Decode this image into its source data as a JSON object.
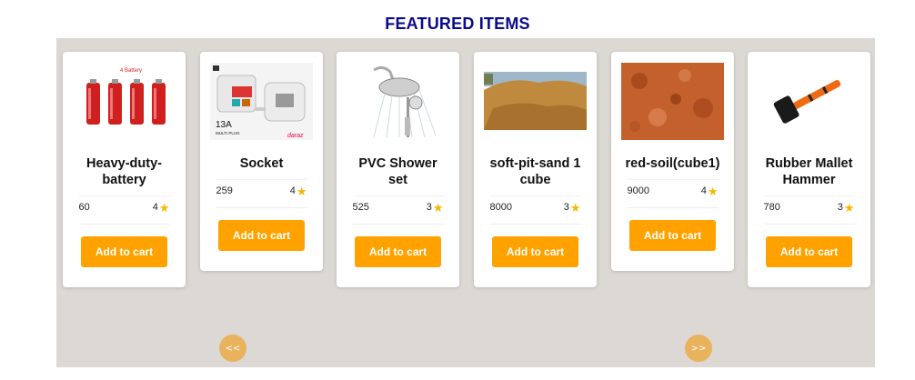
{
  "section": {
    "title": "FEATURED ITEMS"
  },
  "products": [
    {
      "name": "Heavy-duty-battery",
      "price": "60",
      "rating": "4",
      "button": "Add to cart",
      "image_text": "4 Battery"
    },
    {
      "name": "Socket",
      "price": "259",
      "rating": "4",
      "button": "Add to cart",
      "image_text": [
        "13A",
        "MULTI PLUG",
        "daraz"
      ]
    },
    {
      "name": "PVC Shower set",
      "price": "525",
      "rating": "3",
      "button": "Add to cart"
    },
    {
      "name": "soft-pit-sand 1 cube",
      "price": "8000",
      "rating": "3",
      "button": "Add to cart"
    },
    {
      "name": "red-soil(cube1)",
      "price": "9000",
      "rating": "4",
      "button": "Add to cart"
    },
    {
      "name": "Rubber Mallet Hammer",
      "price": "780",
      "rating": "3",
      "button": "Add to cart"
    }
  ],
  "carousel": {
    "prev_label": "<<",
    "next_label": ">>"
  },
  "colors": {
    "title": "#0a0a8a",
    "button": "#ffa200",
    "band": "#dcd8d3",
    "nav": "#e9b35e",
    "star": "#f5b800"
  }
}
